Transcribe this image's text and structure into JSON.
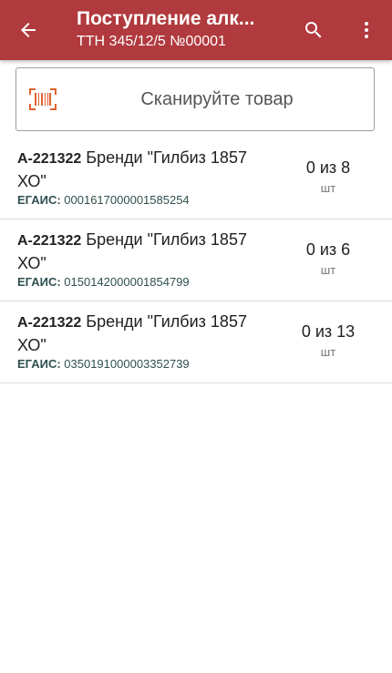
{
  "appbar": {
    "title": "Поступление алк...",
    "subtitle": "ТТН 345/12/5 №00001",
    "back_icon": "arrow-left-icon",
    "search_icon": "search-icon",
    "menu_icon": "more-vert-icon",
    "color": "#b03a3e"
  },
  "scan": {
    "label": "Сканируйте товар",
    "icon": "barcode-icon",
    "icon_color": "#e0622f"
  },
  "items": [
    {
      "code": "А-221322",
      "name": " Бренди \"Гилбиз 1857 ХО\"",
      "egais_label": "ЕГАИС:",
      "egais_value": " 0001617000001585254",
      "qty": "0 из 8",
      "unit": "шт"
    },
    {
      "code": "А-221322",
      "name": " Бренди \"Гилбиз 1857 ХО\"",
      "egais_label": "ЕГАИС:",
      "egais_value": " 0150142000001854799",
      "qty": "0 из 6",
      "unit": "шт"
    },
    {
      "code": "А-221322",
      "name": " Бренди \"Гилбиз 1857 ХО\"",
      "egais_label": "ЕГАИС:",
      "egais_value": " 0350191000003352739",
      "qty": "0 из 13",
      "unit": "шт"
    }
  ]
}
